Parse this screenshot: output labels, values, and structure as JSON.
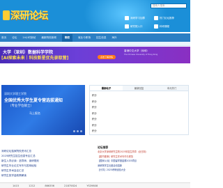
{
  "header": {
    "logo_text": "深研论坛",
    "search_placeholder": "搜索人搜索",
    "buttons": [
      "深研学习加群",
      "热门论坛推荐",
      "研究院入口",
      "科研课程"
    ]
  },
  "nav": {
    "items": [
      "首页",
      "论坛",
      "24小时新帖",
      "最新院校新闻",
      "院校",
      "就业与职场",
      "招生信息",
      "海外"
    ],
    "active_index": 4
  },
  "banner": {
    "line1": "大学（深圳）数据科学学院",
    "line2": "[AI探索未来｜科技新星优先录取营]",
    "pill": "点击了解详情",
    "right_title": "香港中文大学（深圳）",
    "right_sub": "The Chinese University of Hong Kong"
  },
  "promo": {
    "line1": "深圳大学理工学院",
    "line2": "全国优秀大学生夏令营选拔通知",
    "line3": "（专业学位硕士）",
    "line4": "马上报名"
  },
  "left_links": [
    "深研论坛独家院校资讯汇总",
    "2025研究生招生信息专区汇总",
    "新生入学必读：选导师、读研规划",
    "研究生毕业论文写作与答辩经验",
    "研究生学术会议汇总",
    "研究生奖学金政策解读"
  ],
  "mid_panel": {
    "tabs": [
      "最新帖子",
      "最新回复",
      "本月热门"
    ],
    "active_tab": 0,
    "rows": [
      "积分",
      "积分",
      "积分",
      "积分",
      "积分",
      "积分",
      "积分"
    ]
  },
  "right_list": {
    "heading": "论坛推荐",
    "items": [
      {
        "text": "北京大学深圳研究生院2025年招生简章（全日制）",
        "color": "red"
      },
      {
        "text": "【图书推荐】研究生学术写作与规范",
        "color": "red"
      },
      {
        "text": "【国家公派】中国留学基金委2025项目",
        "color": "blue"
      },
      {
        "text": "深研院学生社团活动招新",
        "color": "blue"
      },
      {
        "text": "【分享】2025考研经验大全",
        "color": "blue"
      }
    ]
  },
  "stats": {
    "values": [
      "1415",
      "1212",
      "866356",
      "21875824",
      "YS39808"
    ]
  },
  "colors": {
    "header_bg": "#1b8fd8",
    "nav_bg": "#2b7fc4",
    "logo_text": "#ffe14d",
    "banner_bg": "#6b3fd8",
    "promo_bg": "#2f7be6"
  }
}
